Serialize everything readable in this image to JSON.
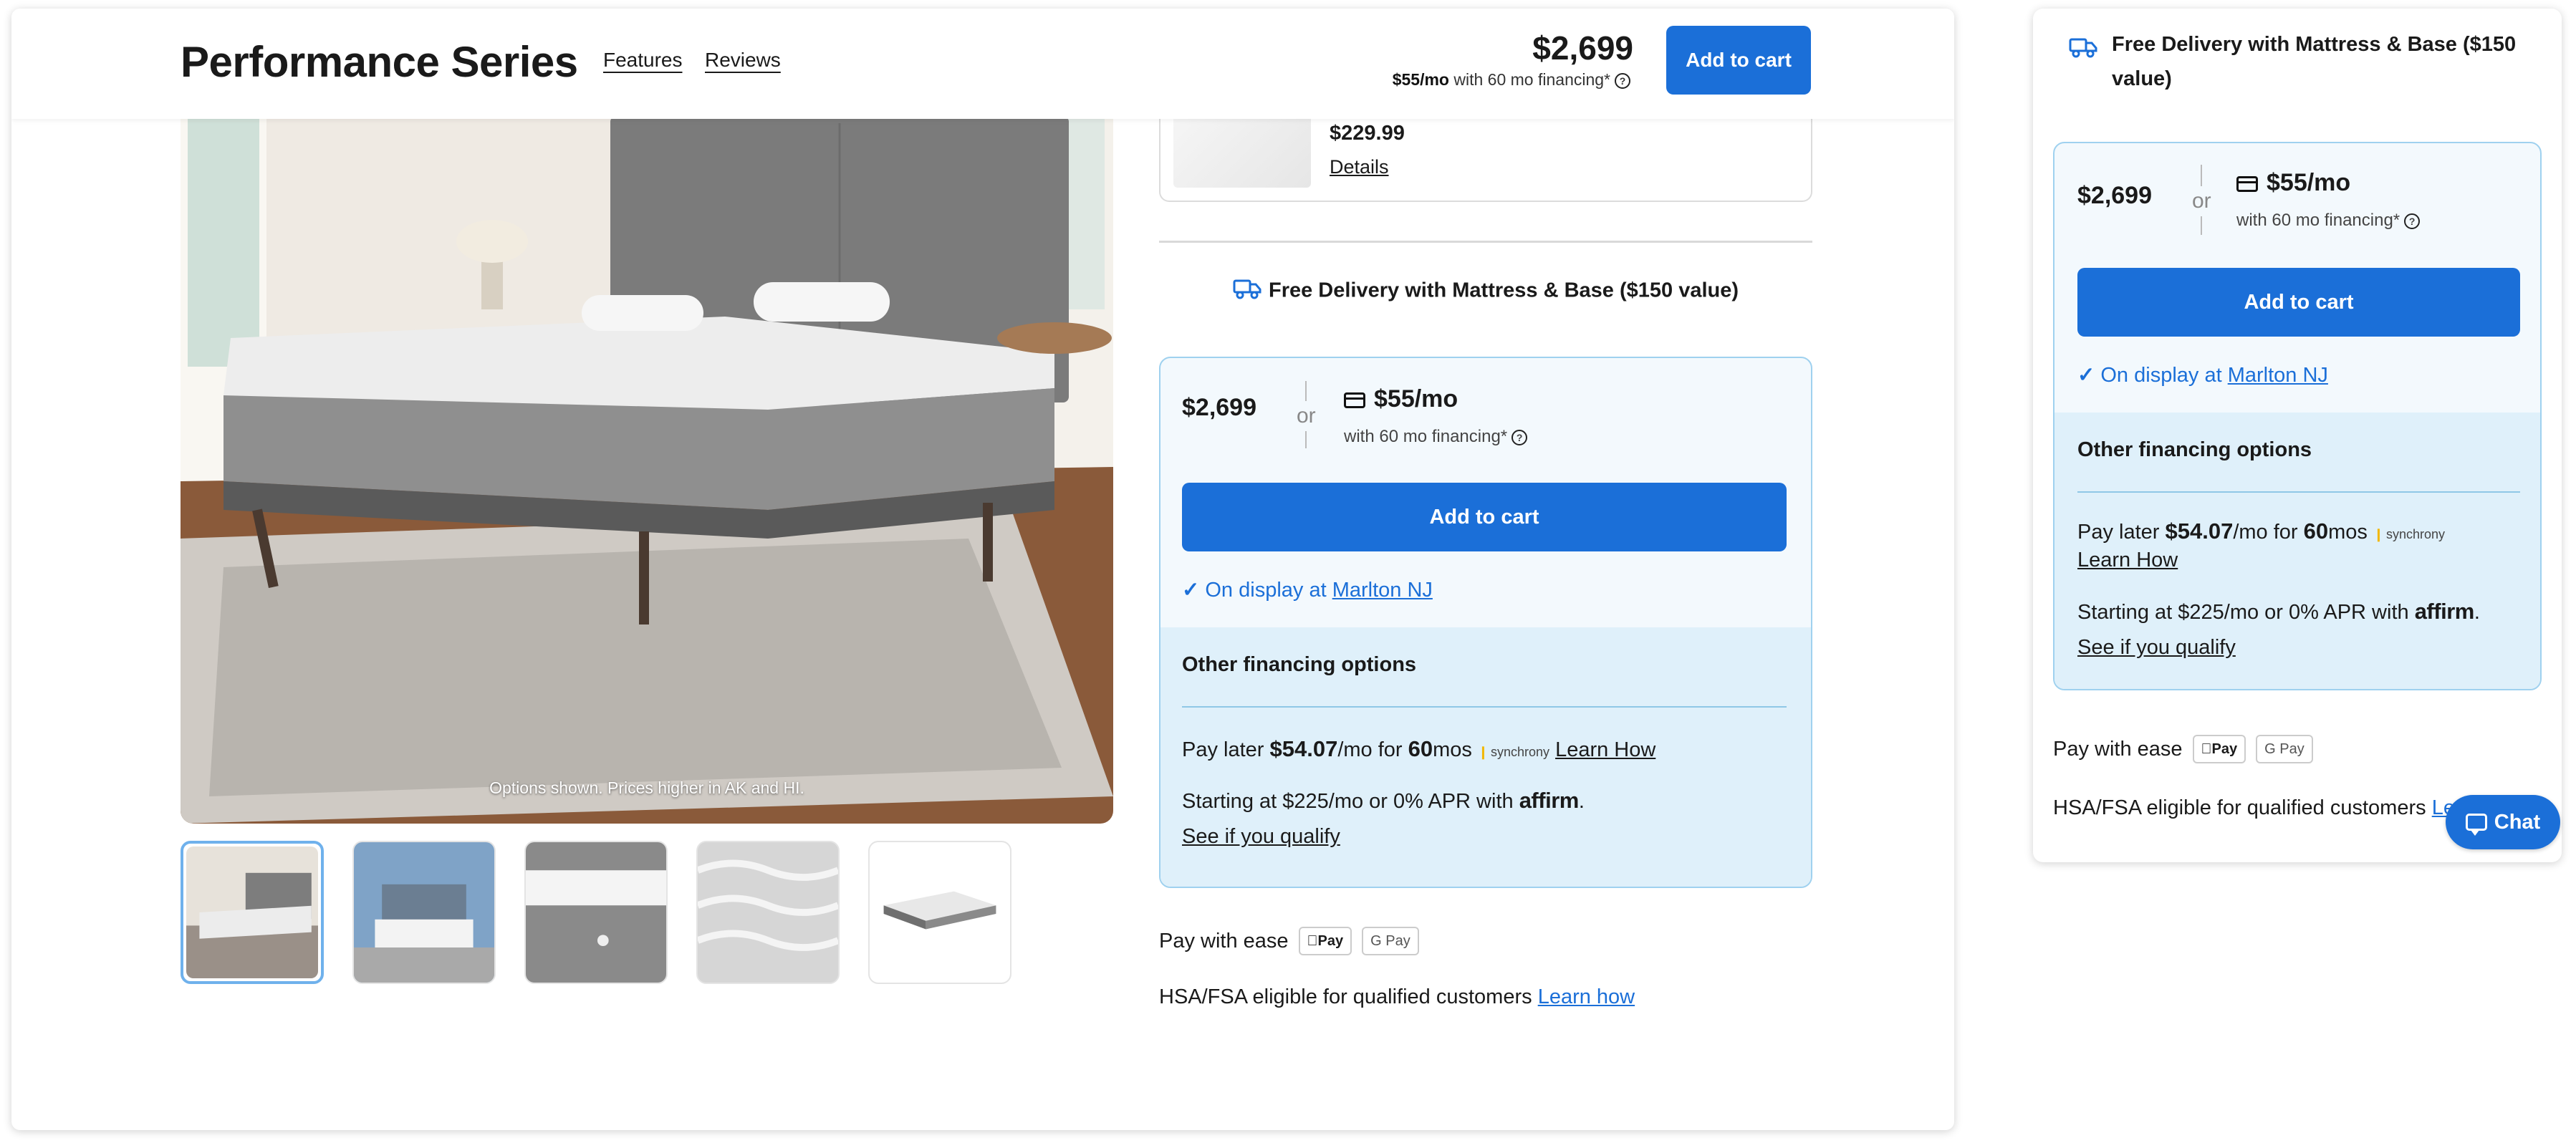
{
  "header": {
    "title": "Performance Series",
    "nav": [
      "Features",
      "Reviews"
    ],
    "price": "$2,699",
    "financing_amount": "$55/mo",
    "financing_text": " with 60 mo financing*",
    "add_to_cart": "Add to cart"
  },
  "gallery": {
    "caption": "Options shown. Prices higher in AK and HI.",
    "thumbnails": [
      "thumbnail-1",
      "thumbnail-2",
      "thumbnail-3",
      "thumbnail-4",
      "thumbnail-5"
    ],
    "active_index": 0
  },
  "addon": {
    "price": "$229.99",
    "details": "Details"
  },
  "delivery": "Free Delivery with Mattress & Base ($150 value)",
  "purchase": {
    "price": "$2,699",
    "or": "or",
    "monthly": "$55/mo",
    "monthly_sub": "with 60 mo financing*",
    "add_to_cart": "Add to cart",
    "display_prefix": "On display at ",
    "display_location": "Marlton NJ"
  },
  "other_financing": {
    "title": "Other financing options",
    "paylater_prefix": "Pay later ",
    "paylater_amount": "$54.07",
    "paylater_mid": "/mo for ",
    "paylater_months": "60",
    "paylater_suffix": "mos",
    "synchrony": "synchrony",
    "learn_how": "Learn How",
    "affirm_text": "Starting at $225/mo or 0% APR with ",
    "affirm_brand": "affirm",
    "affirm_period": ".",
    "qualify": "See if you qualify"
  },
  "pay_with": {
    "label": "Pay with ease",
    "apple": "Pay",
    "google": "G Pay"
  },
  "hsa": {
    "text": "HSA/FSA eligible for qualified customers ",
    "link": "Learn how"
  },
  "chat": "Chat",
  "colors": {
    "primary": "#1b6fd8",
    "card_bg": "#f3f9fd",
    "card_border": "#9fd1ef",
    "other_bg": "#dff0fa"
  }
}
